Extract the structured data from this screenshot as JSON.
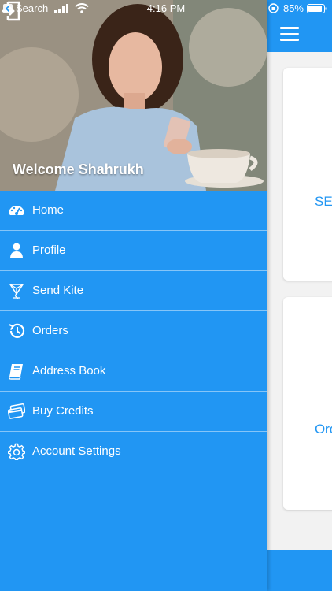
{
  "status_bar": {
    "back_app": "Search",
    "time": "4:16 PM",
    "battery_percent": "85%"
  },
  "drawer": {
    "welcome_text": "Welcome Shahrukh",
    "menu": [
      {
        "label": "Home",
        "icon": "dashboard-icon"
      },
      {
        "label": "Profile",
        "icon": "person-icon"
      },
      {
        "label": "Send Kite",
        "icon": "kite-icon"
      },
      {
        "label": "Orders",
        "icon": "history-icon"
      },
      {
        "label": "Address Book",
        "icon": "address-book-icon"
      },
      {
        "label": "Buy Credits",
        "icon": "credit-cards-icon"
      },
      {
        "label": "Account Settings",
        "icon": "gear-icon"
      }
    ]
  },
  "main": {
    "card1_label": "SE",
    "card2_label": "Ord"
  },
  "colors": {
    "primary": "#2196F3",
    "background": "#f2f2f2",
    "card": "#ffffff"
  }
}
